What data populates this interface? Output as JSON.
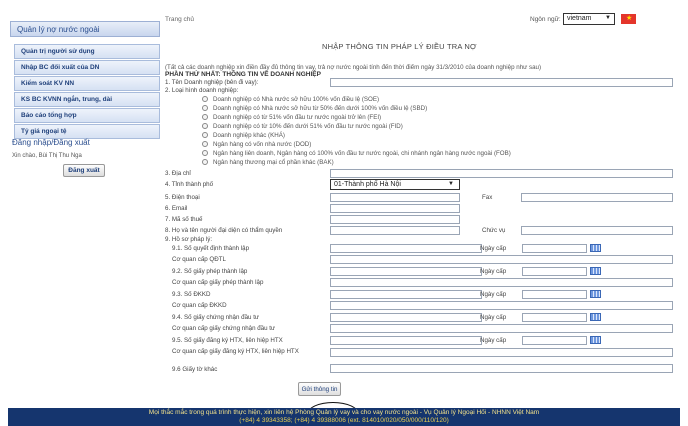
{
  "sidebar": {
    "title": "Quản lý nợ nước ngoài",
    "items": [
      {
        "label": "Quản trị người sử dụng"
      },
      {
        "label": "Nhập BC đối xuất của DN"
      },
      {
        "label": "Kiểm soát KV NN"
      },
      {
        "label": "KS BC KVNN ngắn, trung, dài"
      },
      {
        "label": "Báo cáo tổng hợp"
      },
      {
        "label": "Tỷ giá ngoại tệ"
      }
    ],
    "login_title": "Đăng nhập/Đăng xuất",
    "greeting": "Xin chào, Bùi Thị Thu Nga",
    "logout_label": "Đăng xuất"
  },
  "topbar": {
    "home_link": "Trang chủ",
    "language_label": "Ngôn ngữ:",
    "language_value": "vietnam"
  },
  "form": {
    "title": "NHẬP THÔNG TIN PHÁP LÝ ĐIỀU TRA NỢ",
    "note": "(Tất cả các doanh nghiệp xin điền đầy đủ thông tin vay, trả nợ nước ngoài tính đến thời điểm ngày 31/3/2010 của doanh nghiệp như sau)",
    "part_title": "PHẦN THỨ NHẤT: THÔNG TIN VỀ DOANH NGHIỆP",
    "field_name": "1. Tên Doanh nghiệp (bên đi vay):",
    "field_type": "2. Loại hình doanh nghiệp:",
    "enterprise_types": [
      "Doanh nghiệp có Nhà nước sở hữu 100% vốn điều lệ (SOE)",
      "Doanh nghiệp có Nhà nước sở hữu từ 50% đến dưới 100% vốn điều lệ (SBD)",
      "Doanh nghiệp có từ 51% vốn đầu tư nước ngoài trở lên (FEI)",
      "Doanh nghiệp có từ 10% đến dưới 51% vốn đầu tư nước ngoài (FID)",
      "Doanh nghiệp khác (KHÁ)",
      "Ngân hàng có vốn nhà nước (DOD)",
      "Ngân hàng liên doanh, Ngân hàng có 100% vốn đầu tư nước ngoài, chi nhánh ngân hàng nước ngoài (FOB)",
      "Ngân hàng thương mại cổ phần khác (BAK)"
    ],
    "field_address": "3. Địa chỉ",
    "field_city": "4. Tỉnh thành phố",
    "city_value": "01-Thành phố Hà Nội",
    "field_phone": "5. Điện thoại",
    "label_fax": "Fax",
    "field_email": "6. Email",
    "field_tax": "7. Mã số thuế",
    "field_rep": "8. Họ và tên người đại diện có thẩm quyền",
    "label_position": "Chức vụ",
    "field_legal": "9. Hồ sơ pháp lý:",
    "legal_rows": [
      {
        "label": "9.1. Số quyết định thành lập",
        "has_date": true
      },
      {
        "label": "Cơ quan cấp QĐTL",
        "has_date": false
      },
      {
        "label": "9.2. Số giấy phép thành lập",
        "has_date": true
      },
      {
        "label": "Cơ quan cấp giấy phép thành lập",
        "has_date": false
      },
      {
        "label": "9.3. Số ĐKKD",
        "has_date": true
      },
      {
        "label": "Cơ quan cấp ĐKKD",
        "has_date": false
      },
      {
        "label": "9.4. Số giấy chứng nhận đầu tư",
        "has_date": true
      },
      {
        "label": "Cơ quan cấp giấy chứng nhận đầu tư",
        "has_date": false
      },
      {
        "label": "9.5. Số giấy đăng ký HTX, liên hiệp HTX",
        "has_date": true
      },
      {
        "label": "Cơ quan cấp giấy đăng ký HTX, liên hiệp HTX",
        "has_date": false
      },
      {
        "label": "9.6 Giấy tờ khác",
        "has_date": false
      }
    ],
    "date_label": "Ngày cấp",
    "submit_label": "Gửi thông tin"
  },
  "footer": {
    "line1": "Mọi thắc mắc trong quá trình thực hiện, xin liên hệ Phòng Quản lý vay và cho vay nước ngoài - Vụ Quản lý Ngoại Hối - NHNN Việt Nam",
    "line2": "(+84) 4 39343358; (+84) 4 39388006 (ext. 814010/020/050/000/110/120)"
  }
}
